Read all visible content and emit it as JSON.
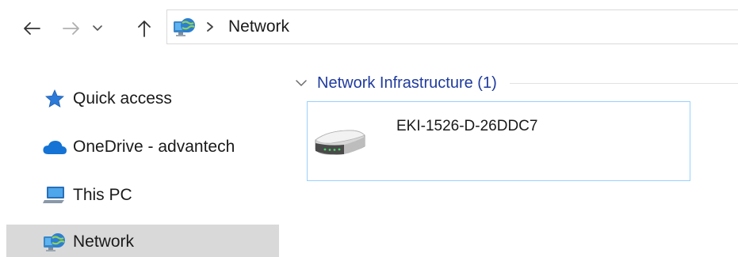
{
  "navigation": {
    "back_icon": "arrow-left-icon",
    "forward_icon": "arrow-right-icon",
    "recent_icon": "chevron-down-icon",
    "up_icon": "arrow-up-icon"
  },
  "address_bar": {
    "location_icon": "network-icon",
    "separator_icon": "chevron-right-icon",
    "breadcrumb": [
      "Network"
    ]
  },
  "sidebar": {
    "items": [
      {
        "label": "Quick access",
        "icon": "star-icon",
        "selected": false
      },
      {
        "label": "OneDrive - advantech",
        "icon": "cloud-icon",
        "selected": false
      },
      {
        "label": "This PC",
        "icon": "computer-icon",
        "selected": false
      },
      {
        "label": "Network",
        "icon": "network-icon",
        "selected": true
      }
    ]
  },
  "content": {
    "group": {
      "title": "Network Infrastructure (1)",
      "expanded": true,
      "chevron_icon": "chevron-down-icon"
    },
    "items": [
      {
        "name": "EKI-1526-D-26DDC7",
        "icon": "router-icon"
      }
    ]
  },
  "colors": {
    "group_title": "#1f3b9e",
    "selected_bg": "#d9d9d9",
    "tile_border": "#99d1ff",
    "address_border": "#d9d9d9"
  }
}
